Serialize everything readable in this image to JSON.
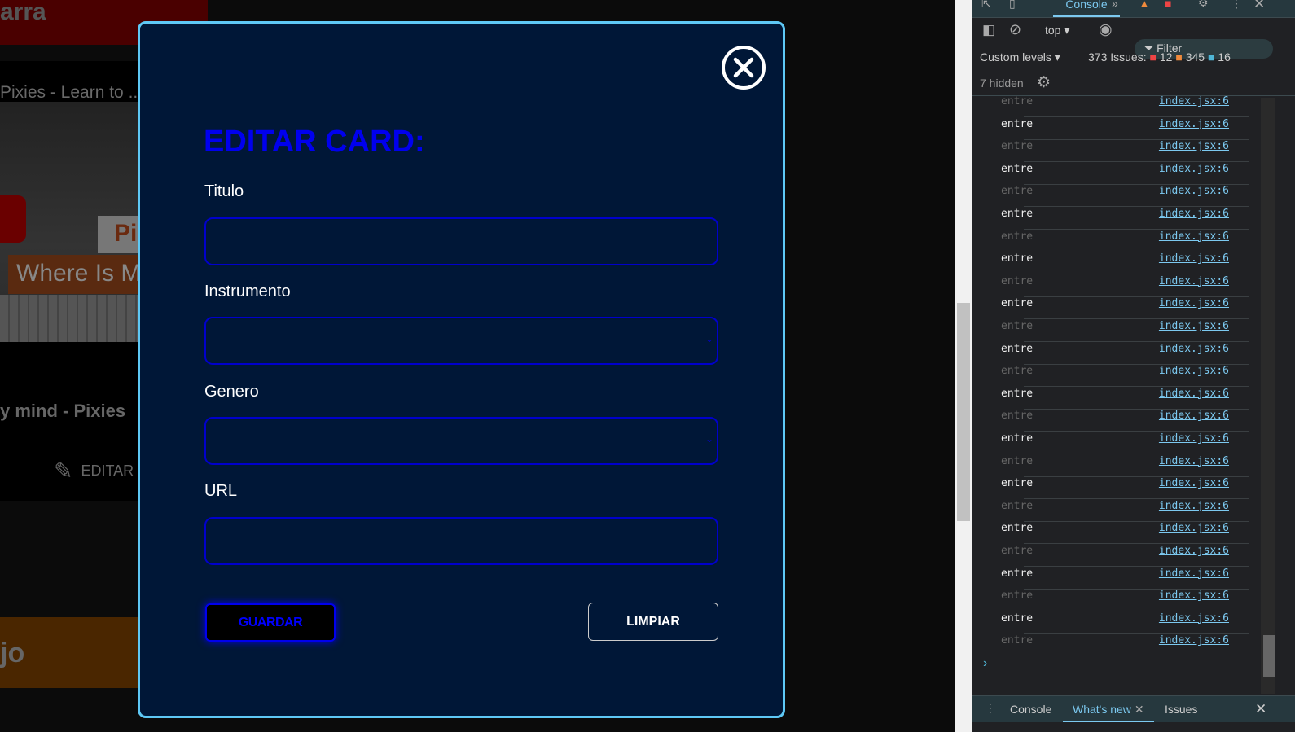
{
  "background": {
    "header_text": "arra",
    "card_title": "Pixies - Learn to ...",
    "thumb_badge": "Pi",
    "thumb_caption": "Where Is My",
    "song_name": "y mind - Pixies",
    "edit_label": "EDITAR",
    "next_header": "jo"
  },
  "modal": {
    "title": "EDITAR CARD:",
    "fields": [
      {
        "label": "Titulo",
        "value": ""
      },
      {
        "label": "Instrumento",
        "value": ""
      },
      {
        "label": "Genero",
        "value": ""
      },
      {
        "label": "URL",
        "value": ""
      }
    ],
    "save_label": "GUARDAR",
    "clear_label": "LIMPIAR"
  },
  "devtools": {
    "tab_console": "Console",
    "context": "top",
    "filter_placeholder": "Filter",
    "levels": "Custom levels",
    "issues_label": "373 Issues:",
    "errors": "12",
    "warnings": "345",
    "info": "16",
    "hidden": "7 hidden",
    "logs": [
      {
        "msg": "entre",
        "src": "index.jsx:6",
        "dim": true
      },
      {
        "msg": "entre",
        "src": "index.jsx:6",
        "dim": false
      },
      {
        "msg": "entre",
        "src": "index.jsx:6",
        "dim": true
      },
      {
        "msg": "entre",
        "src": "index.jsx:6",
        "dim": false
      },
      {
        "msg": "entre",
        "src": "index.jsx:6",
        "dim": true
      },
      {
        "msg": "entre",
        "src": "index.jsx:6",
        "dim": false
      },
      {
        "msg": "entre",
        "src": "index.jsx:6",
        "dim": true
      },
      {
        "msg": "entre",
        "src": "index.jsx:6",
        "dim": false
      },
      {
        "msg": "entre",
        "src": "index.jsx:6",
        "dim": true
      },
      {
        "msg": "entre",
        "src": "index.jsx:6",
        "dim": false
      },
      {
        "msg": "entre",
        "src": "index.jsx:6",
        "dim": true
      },
      {
        "msg": "entre",
        "src": "index.jsx:6",
        "dim": false
      },
      {
        "msg": "entre",
        "src": "index.jsx:6",
        "dim": true
      },
      {
        "msg": "entre",
        "src": "index.jsx:6",
        "dim": false
      },
      {
        "msg": "entre",
        "src": "index.jsx:6",
        "dim": true
      },
      {
        "msg": "entre",
        "src": "index.jsx:6",
        "dim": false
      },
      {
        "msg": "entre",
        "src": "index.jsx:6",
        "dim": true
      },
      {
        "msg": "entre",
        "src": "index.jsx:6",
        "dim": false
      },
      {
        "msg": "entre",
        "src": "index.jsx:6",
        "dim": true
      },
      {
        "msg": "entre",
        "src": "index.jsx:6",
        "dim": false
      },
      {
        "msg": "entre",
        "src": "index.jsx:6",
        "dim": true
      },
      {
        "msg": "entre",
        "src": "index.jsx:6",
        "dim": false
      },
      {
        "msg": "entre",
        "src": "index.jsx:6",
        "dim": true
      },
      {
        "msg": "entre",
        "src": "index.jsx:6",
        "dim": false
      },
      {
        "msg": "entre",
        "src": "index.jsx:6",
        "dim": true
      }
    ],
    "drawer_tabs": [
      "Console",
      "What's new",
      "Issues"
    ]
  },
  "colors": {
    "modal_bg": "#001737",
    "modal_border": "#5ec8f5",
    "accent": "#0000ee"
  }
}
